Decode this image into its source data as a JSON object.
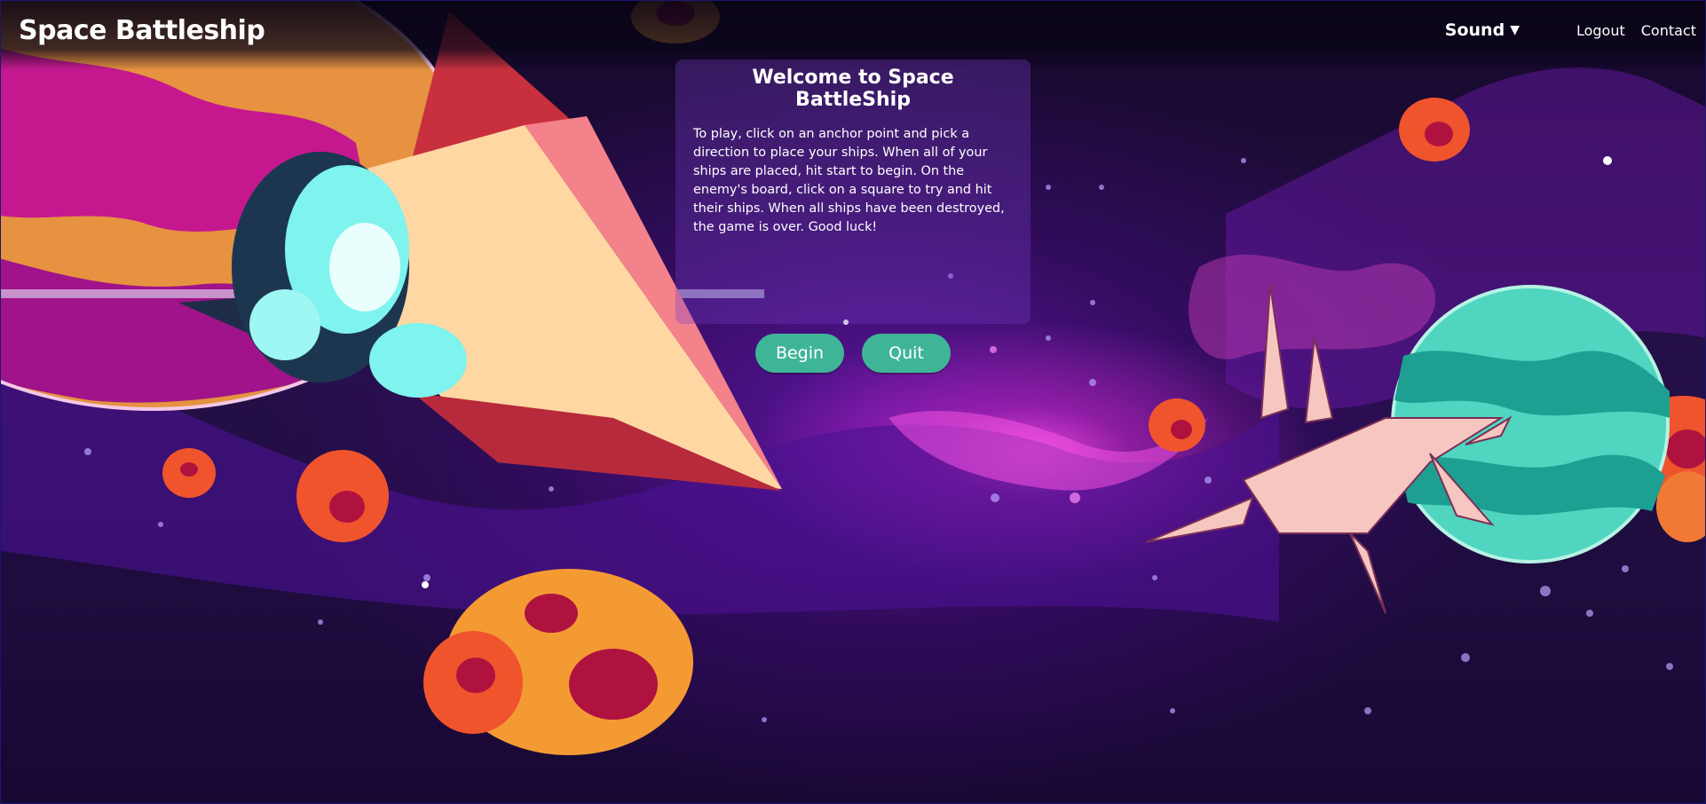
{
  "header": {
    "title": "Space Battleship",
    "sound_label": "Sound",
    "sound_caret": "▼",
    "links": [
      "Logout",
      "Contact"
    ]
  },
  "welcome": {
    "title": "Welcome to Space BattleShip",
    "instructions": "To play, click on an anchor point and pick a direction to place your ships. When all of your ships are placed, hit start to begin. On the enemy's board, click on a square to try and hit their ships. When all ships have been destroyed, the game is over. Good luck!"
  },
  "actions": {
    "begin_label": "Begin",
    "quit_label": "Quit"
  },
  "colors": {
    "button": "#3fb597",
    "background": "#241048",
    "nebula": "#e143d8"
  },
  "icons": [
    "chevron-down-icon"
  ]
}
